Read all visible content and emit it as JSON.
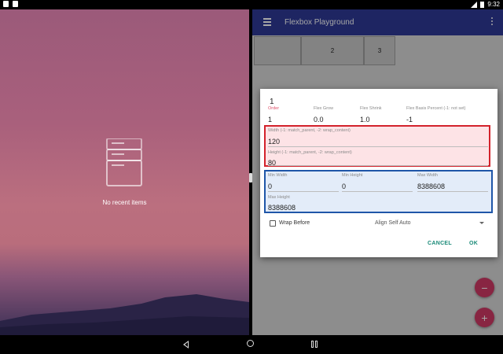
{
  "status_bar": {
    "time": "9:32"
  },
  "recents": {
    "empty_text": "No recent items"
  },
  "app": {
    "title": "Flexbox Playground",
    "flex_items": [
      "",
      "2",
      "3"
    ]
  },
  "dialog": {
    "title": "1",
    "labels": {
      "order": "Order",
      "flex_grow": "Flex Grow",
      "flex_shrink": "Flex Shrink",
      "flex_basis": "Flex Basis Percent (-1: not set)",
      "width": "Width (-1: match_parent, -2: wrap_content)",
      "height": "Height (-1: match_parent, -2: wrap_content)",
      "min_width": "Min Width",
      "min_height": "Min Height",
      "max_width": "Max Width",
      "max_height": "Max Height"
    },
    "values": {
      "order": "1",
      "flex_grow": "0.0",
      "flex_shrink": "1.0",
      "flex_basis": "-1",
      "width": "120",
      "height": "80",
      "min_width": "0",
      "min_height": "0",
      "max_width": "8388608",
      "max_height": "8388608"
    },
    "wrap_before_label": "Wrap Before",
    "align_self": "Align Self Auto",
    "cancel_label": "CANCEL",
    "ok_label": "OK"
  },
  "colors": {
    "toolbar": "#2e3a97",
    "accent": "#e0506a",
    "fab": "#d13a66",
    "dialog_button": "#1a8a78",
    "highlight_red": "#d3222c",
    "highlight_blue": "#1f56a8"
  },
  "icons": [
    "hamburger-menu-icon",
    "overflow-menu-icon",
    "remove-icon",
    "add-icon",
    "back-icon",
    "home-icon",
    "recents-icon",
    "recent-apps-placeholder-icon"
  ]
}
